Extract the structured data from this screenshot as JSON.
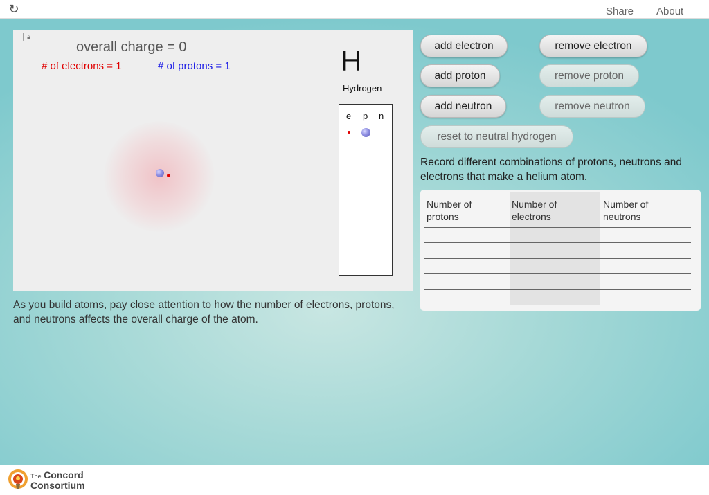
{
  "topbar": {
    "reload_icon": "reload-icon",
    "share_label": "Share",
    "about_label": "About"
  },
  "simulation": {
    "overall_charge": "overall charge = 0",
    "electrons_label": "# of electrons = 1",
    "protons_label": "# of protons = 1",
    "element_symbol": "H",
    "element_name": "Hydrogen",
    "particle_columns": [
      "e",
      "p",
      "n"
    ],
    "colors": {
      "electron": "#e00000",
      "proton": "#1a1ae6"
    }
  },
  "instruction": "As you build atoms, pay close attention to how the number of electrons, protons, and neutrons affects the overall charge of the atom.",
  "controls": {
    "add_electron": "add electron",
    "remove_electron": "remove electron",
    "add_proton": "add proton",
    "remove_proton": "remove proton",
    "add_neutron": "add neutron",
    "remove_neutron": "remove neutron",
    "reset": "reset to neutral hydrogen"
  },
  "prompt": "Record different combinations of protons, neutrons and electrons that make a helium atom.",
  "table": {
    "headers": [
      "Number of protons",
      "Number of electrons",
      "Number of neutrons"
    ],
    "rows": [
      [
        "",
        "",
        ""
      ],
      [
        "",
        "",
        ""
      ],
      [
        "",
        "",
        ""
      ],
      [
        "",
        "",
        ""
      ],
      [
        "",
        "",
        ""
      ]
    ]
  },
  "footer": {
    "logo_small": "The",
    "logo_line1": "Concord",
    "logo_line2": "Consortium"
  }
}
